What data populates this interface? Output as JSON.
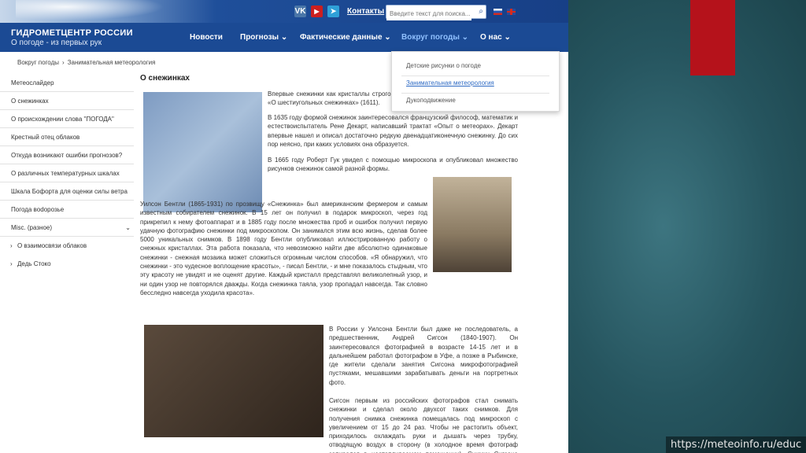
{
  "topbar": {
    "social": [
      "VK",
      "▶",
      "➤"
    ],
    "contacts": "Контакты",
    "search_placeholder": "Введите текст для поиска...",
    "search_icon": "magnifier-icon",
    "languages": [
      "ru",
      "en"
    ]
  },
  "brand": {
    "title": "ГИДРОМЕТЦЕНТР РОССИИ",
    "subtitle": "О погоде - из первых рук"
  },
  "nav": {
    "items": [
      "Новости",
      "Прогнозы ⌄",
      "Фактические данные ⌄",
      "Вокруг погоды ⌄",
      "О нас ⌄"
    ],
    "active_index": 3
  },
  "dropdown": {
    "items": [
      "Детские рисунки о погоде",
      "Занимательная метеорология",
      "Дукоподвижение"
    ],
    "selected_index": 1
  },
  "breadcrumb": [
    "Вокруг погоды",
    "Занимательная метеорология"
  ],
  "sidebar": {
    "items": [
      "Метеослайдер",
      "О снежинках",
      "О происхождении слова \"ПОГОДА\"",
      "Крестный отец облаков",
      "Откуда возникают ошибки прогнозов?",
      "О различных температурных шкалах",
      "Шкала Бофорта для оценки силы ветра",
      "Погода вodорозье",
      "Misc. (разное)"
    ],
    "misc_chevron": "⌄",
    "subitems": [
      "О взаимосвязи облаков",
      "Дедь Стоко"
    ]
  },
  "content": {
    "title": "О снежинках",
    "p1": "Впервые снежинки как кристаллы строгой формы описал Иоганн Кеплер в работе «О шестиугольных снежинках» (1611).",
    "p2": "В 1635 году формой снежинок заинтересовался французский философ, математик и естествоиспытатель Рене Декарт, написавший трактат «Опыт о метеорах». Декарт впервые нашел и описал достаточно редкую двенадцатиконечную снежинку. До сих пор неясно, при каких условиях она образуется.",
    "p3": "В 1665 году Роберт Гук увидел с помощью микроскопа и опубликовал множество рисунков снежинок самой разной формы.",
    "p4": "Уилсон Бентли (1865-1931) по прозвищу «Снежинка» был американским фермером и самым известным собирателем снежинок. В 15 лет он получил в подарок микроскоп, через год прикрепил к нему фотоаппарат и в 1885 году после множества проб и ошибок получил первую удачную фотографию снежинки под микроскопом. Он занимался этим всю жизнь, сделав более 5000 уникальных снимков. В 1898 году Бентли опубликовал иллюстрированную работу о снежных кристаллах. Эта работа показала, что невозможно найти две абсолютно одинаковые снежинки - снежная мозаика может сложиться огромным числом способов. «Я обнаружил, что снежинки - это чудесное воплощение красоты», - писал Бентли, - и мне показалось стыдным, что эту красоту не увидят и не оценят другие. Каждый кристалл представлял великолепный узор, и ни один узор не повторялся дважды. Когда снежинка таяла, узор пропадал навсегда. Так словно бесследно навсегда уходила красота».",
    "p5": "В России у Уилсона Бентли был даже не последователь, а предшественник, Андрей Сигсон (1840-1907). Он заинтересовался фотографией в возрасте 14-15 лет и в дальнейшем работал фотографом в Уфе, а позже в Рыбинске, где жители сделали занятия Сигсона микрофотографией пустяками, мешавшими зарабатывать деньги на портретных фото.",
    "p6": "Сигсон первым из российских фотографов стал снимать снежинки и сделал около двухсот таких снимков. Для получения снимка снежинка помещалась под микроскоп с увеличением от 15 до 24 раз. Чтобы не растопить объект, приходилось охлаждать руки и дышать через трубку, отводящую воздух в сторону (в холодное время фотограф запирался в неотапливаемом помещении). Снимки Сигсона получили признание на многих выставках."
  },
  "slide": {
    "url": "https://meteoinfo.ru/educ"
  },
  "colors": {
    "navbar": "#1b4a94",
    "accent_red": "#b5121b",
    "link": "#2f6bc4"
  }
}
